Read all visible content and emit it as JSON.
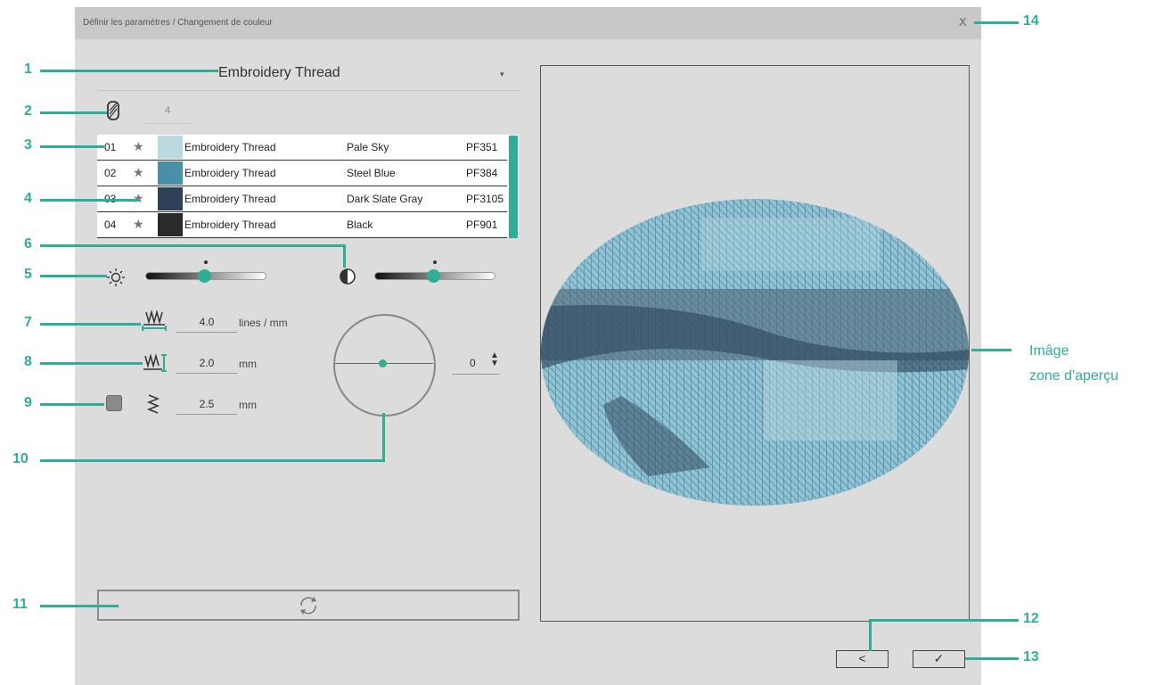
{
  "dialog": {
    "title": "Définir les paramètres / Changement de couleur",
    "close_label": "X"
  },
  "thread_select": {
    "value": "Embroidery Thread",
    "arrow": "▾"
  },
  "thread_count": "4",
  "threads": [
    {
      "num": "01",
      "type": "Embroidery Thread",
      "name": "Pale Sky",
      "code": "PF351",
      "color": "#bcd9e0"
    },
    {
      "num": "02",
      "type": "Embroidery Thread",
      "name": "Steel Blue",
      "code": "PF384",
      "color": "#4a8fa8"
    },
    {
      "num": "03",
      "type": "Embroidery Thread",
      "name": "Dark Slate Gray",
      "code": "PF3105",
      "color": "#2c4258"
    },
    {
      "num": "04",
      "type": "Embroidery Thread",
      "name": "Black",
      "code": "PF901",
      "color": "#2a2a2a"
    }
  ],
  "brightness": {
    "level": 0.5
  },
  "contrast": {
    "level": 0.5
  },
  "density": {
    "value": "4.0",
    "unit": "lines / mm"
  },
  "stitch_length": {
    "value": "2.0",
    "unit": "mm"
  },
  "run_pitch": {
    "value": "2.5",
    "unit": "mm"
  },
  "angle": {
    "value": "0"
  },
  "buttons": {
    "back": "<",
    "ok": "✓"
  },
  "preview_caption": {
    "line1": "Imâge",
    "line2": "zone d'aperçu"
  },
  "callouts": [
    "1",
    "2",
    "3",
    "4",
    "5",
    "6",
    "7",
    "8",
    "9",
    "10",
    "11",
    "12",
    "13",
    "14"
  ],
  "colors": {
    "accent": "#2fae97",
    "dialog_bg": "#dcdcdc",
    "titlebar_bg": "#c8c8c8"
  }
}
